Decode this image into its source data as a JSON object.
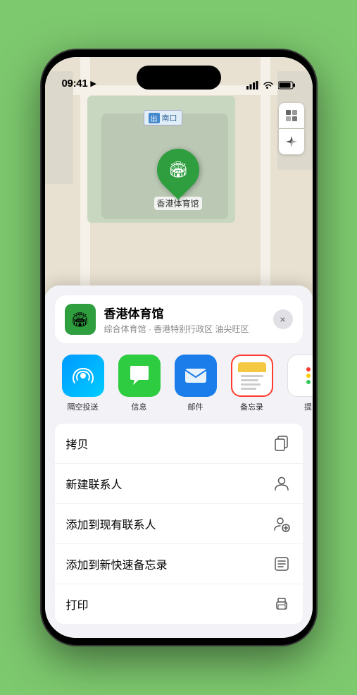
{
  "status_bar": {
    "time": "09:41",
    "navigation_arrow": "▶"
  },
  "map": {
    "label_text": "南口",
    "label_prefix": "出"
  },
  "controls": {
    "map_type_icon": "🗺",
    "location_icon": "↗"
  },
  "pin": {
    "label": "香港体育馆"
  },
  "location_card": {
    "name": "香港体育馆",
    "subtitle": "综合体育馆 · 香港特别行政区 油尖旺区",
    "close_label": "×"
  },
  "share_items": [
    {
      "id": "airdrop",
      "label": "隔空投送",
      "icon_class": "icon-airdrop",
      "icon": "📡"
    },
    {
      "id": "messages",
      "label": "信息",
      "icon_class": "icon-messages",
      "icon": "💬"
    },
    {
      "id": "mail",
      "label": "邮件",
      "icon_class": "icon-mail",
      "icon": "✉"
    },
    {
      "id": "notes",
      "label": "备忘录",
      "icon_class": "icon-notes",
      "icon": "notes",
      "selected": true
    },
    {
      "id": "more",
      "label": "提",
      "icon_class": "icon-more",
      "icon": "more"
    }
  ],
  "actions": [
    {
      "id": "copy",
      "label": "拷贝",
      "icon": "copy"
    },
    {
      "id": "new-contact",
      "label": "新建联系人",
      "icon": "person"
    },
    {
      "id": "add-contact",
      "label": "添加到现有联系人",
      "icon": "person-add"
    },
    {
      "id": "quick-note",
      "label": "添加到新快速备忘录",
      "icon": "note"
    },
    {
      "id": "print",
      "label": "打印",
      "icon": "print"
    }
  ]
}
